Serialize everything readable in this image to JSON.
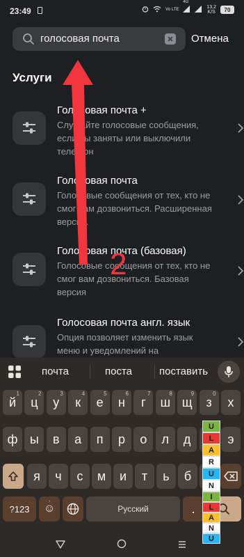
{
  "status": {
    "time": "23:49",
    "network": "4G",
    "volte": "Vo LTE",
    "speed_value": "13,2",
    "speed_unit": "K/S",
    "battery": "70"
  },
  "search": {
    "value": "голосовая почта",
    "cancel_label": "Отмена"
  },
  "section_title": "Услуги",
  "services": [
    {
      "title": "Голосовая почта +",
      "description": "Слушайте голосовые сообщения, если вы заняты или выключили телефон"
    },
    {
      "title": "Голосовая почта",
      "description": "Голосовые сообщения от тех, кто не смог вам дозвониться. Расширенная версия."
    },
    {
      "title": "Голосовая почта (базовая)",
      "description": "Голосовые сообщения от тех, кто не смог вам дозвониться. Базовая версия"
    },
    {
      "title": "Голосовая почта англ. язык",
      "description": "Опция позволяет изменить язык меню и уведомлений на"
    }
  ],
  "annotation": {
    "number": "2",
    "color": "#f0363f"
  },
  "keyboard": {
    "suggestions": [
      "почта",
      "поста",
      "поставить"
    ],
    "row1": [
      {
        "k": "й",
        "h": "1"
      },
      {
        "k": "ц",
        "h": "2"
      },
      {
        "k": "у",
        "h": "3"
      },
      {
        "k": "к",
        "h": "4"
      },
      {
        "k": "е",
        "h": "5"
      },
      {
        "k": "н",
        "h": "6"
      },
      {
        "k": "г",
        "h": "7"
      },
      {
        "k": "ш",
        "h": "8"
      },
      {
        "k": "щ",
        "h": "9"
      },
      {
        "k": "з",
        "h": "0"
      },
      {
        "k": "х",
        "h": ""
      }
    ],
    "row2": [
      "ф",
      "ы",
      "в",
      "а",
      "п",
      "р",
      "о",
      "л",
      "д",
      "ж",
      "э"
    ],
    "row3": [
      "я",
      "ч",
      "с",
      "м",
      "и",
      "т",
      "ь",
      "б",
      "ю"
    ],
    "numbers_label": "?123",
    "emoji_label": "☺",
    "comma_label": ",",
    "space_label": "Русский",
    "period_label": ".",
    "accent_color": "#c9a98a"
  },
  "watermark": {
    "letters": [
      "U",
      "L",
      "A",
      "R",
      "U",
      "N",
      "I",
      "L",
      "A",
      "N",
      "U"
    ],
    "colors": [
      "#7cb342",
      "#e53935",
      "#fbc02d",
      "#ffffff",
      "#29b6f6",
      "#ffffff",
      "#7cb342",
      "#e53935",
      "#fbc02d",
      "#ffffff",
      "#29b6f6"
    ]
  }
}
